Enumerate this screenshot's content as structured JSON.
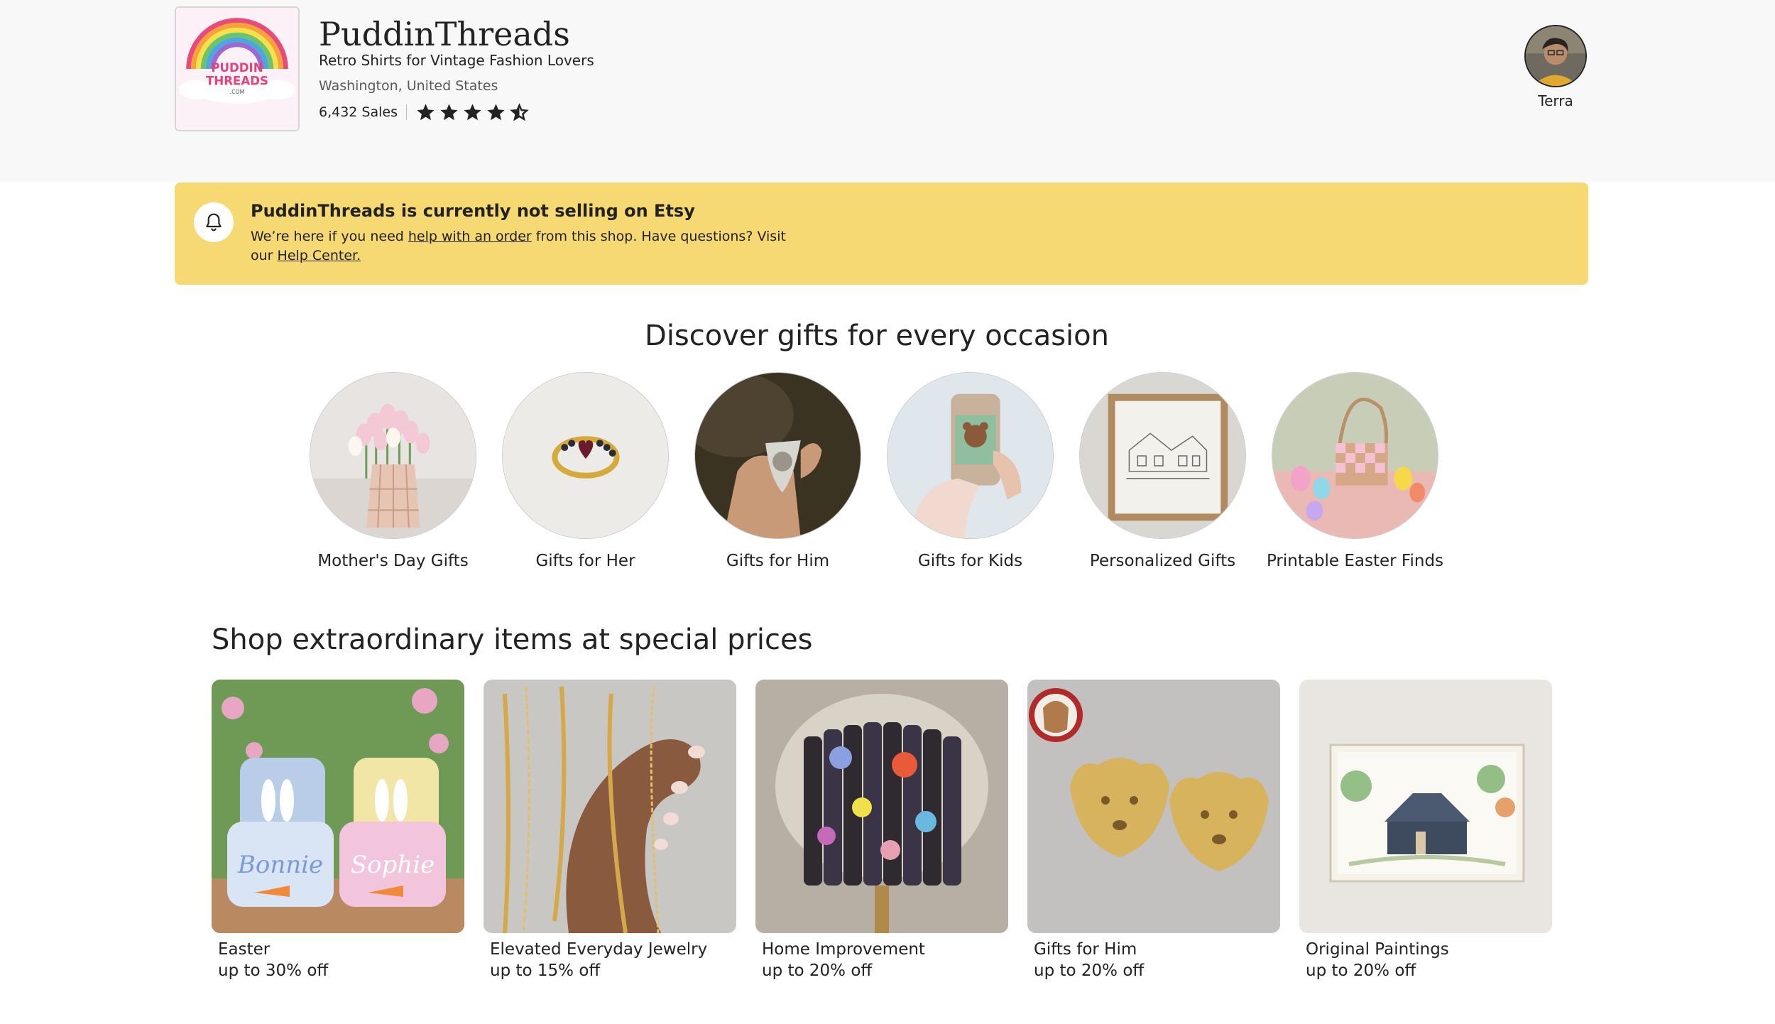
{
  "shop": {
    "name": "PuddinThreads",
    "tagline": "Retro Shirts for Vintage Fashion Lovers",
    "location": "Washington, United States",
    "sales": "6,432 Sales",
    "rating": 4.5,
    "logo_text": [
      "PUDDIN",
      "THREADS",
      ".COM"
    ]
  },
  "owner": {
    "name": "Terra"
  },
  "notice": {
    "title": "PuddinThreads is currently not selling on Etsy",
    "body_before_link1": "We’re here if you need ",
    "link1": "help with an order",
    "body_between": " from this shop. Have questions? Visit our ",
    "link2": "Help Center."
  },
  "occasions": {
    "title": "Discover gifts for every occasion",
    "items": [
      {
        "label": "Mother's Day Gifts"
      },
      {
        "label": "Gifts for Her"
      },
      {
        "label": "Gifts for Him"
      },
      {
        "label": "Gifts for Kids"
      },
      {
        "label": "Personalized Gifts"
      },
      {
        "label": "Printable Easter Finds"
      }
    ]
  },
  "deals": {
    "title": "Shop extraordinary items at special prices",
    "items": [
      {
        "name": "Easter",
        "discount": "up to 30% off",
        "image_text": [
          "Bonnie",
          "Sophie"
        ]
      },
      {
        "name": "Elevated Everyday Jewelry",
        "discount": "up to 15% off"
      },
      {
        "name": "Home Improvement",
        "discount": "up to 20% off"
      },
      {
        "name": "Gifts for Him",
        "discount": "up to 20% off"
      },
      {
        "name": "Original Paintings",
        "discount": "up to 20% off"
      }
    ]
  },
  "colors": {
    "notice_bg": "#f7d974",
    "header_bg": "#f8f8f8",
    "star": "#222222"
  }
}
